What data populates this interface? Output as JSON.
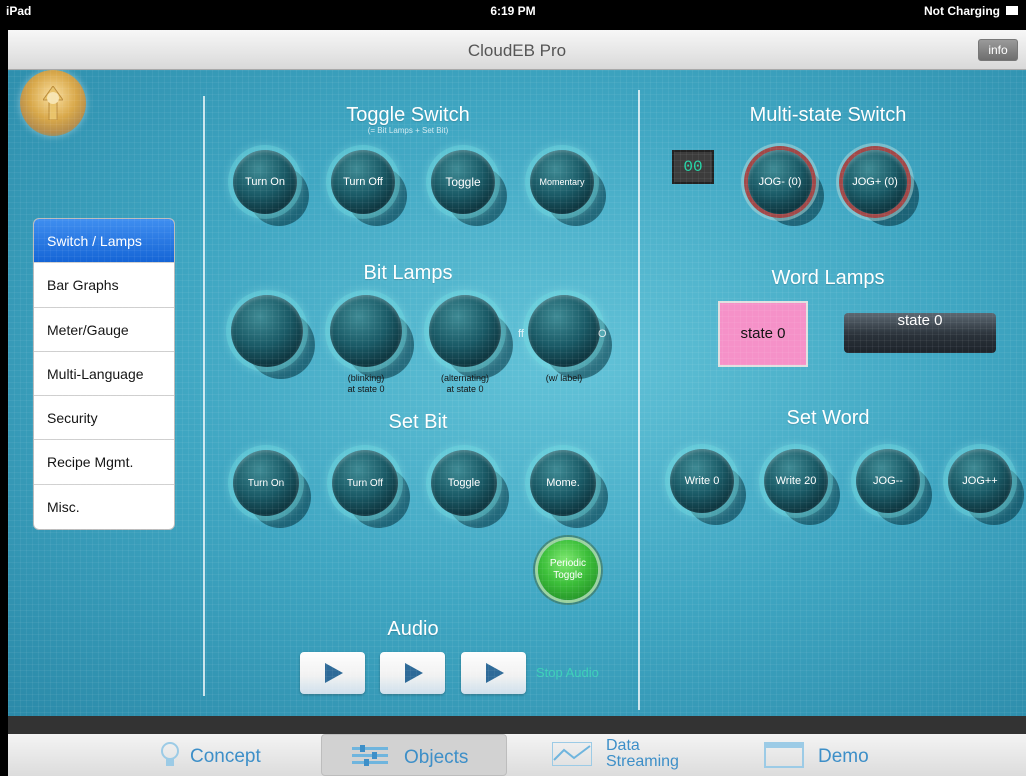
{
  "status_bar": {
    "device": "iPad",
    "time": "6:19 PM",
    "charging": "Not Charging"
  },
  "nav": {
    "title": "CloudEB Pro",
    "info_label": "info"
  },
  "menu": {
    "items": [
      "Switch / Lamps",
      "Bar Graphs",
      "Meter/Gauge",
      "Multi-Language",
      "Security",
      "Recipe Mgmt.",
      "Misc."
    ],
    "selected": "Switch / Lamps"
  },
  "toggle_switch": {
    "title": "Toggle Switch",
    "subtitle": "(= Bit Lamps + Set Bit)",
    "buttons": [
      "Turn On",
      "Turn Off",
      "Toggle",
      "Momentary"
    ]
  },
  "bit_lamps": {
    "title": "Bit Lamps",
    "captions": [
      {
        "line1": "(blinking)",
        "line2": "at state 0"
      },
      {
        "line1": "(alternating)",
        "line2": "at state 0"
      },
      {
        "line1": "(w/ label)",
        "line2": ""
      }
    ],
    "label_left": "ff",
    "label_right": "O"
  },
  "set_bit": {
    "title": "Set Bit",
    "buttons": [
      "Turn On",
      "Turn Off",
      "Toggle",
      "Mome."
    ],
    "periodic_line1": "Periodic",
    "periodic_line2": "Toggle"
  },
  "audio": {
    "title": "Audio",
    "stop_label": "Stop Audio"
  },
  "multi_state": {
    "title": "Multi-state Switch",
    "value": "00",
    "buttons": [
      "JOG- (0)",
      "JOG+ (0)"
    ]
  },
  "word_lamps": {
    "title": "Word Lamps",
    "pink_text": "state 0",
    "dark_text": "state 0"
  },
  "set_word": {
    "title": "Set Word",
    "buttons": [
      "Write 0",
      "Write 20",
      "JOG--",
      "JOG++"
    ]
  },
  "tabs": [
    {
      "label": "Concept",
      "icon": "lightbulb-icon"
    },
    {
      "label": "Objects",
      "icon": "sliders-icon"
    },
    {
      "label": "Data",
      "label2": "Streaming",
      "icon": "chart-icon"
    },
    {
      "label": "Demo",
      "icon": "window-icon"
    }
  ],
  "colors": {
    "accent": "#1565d6",
    "tab_text": "#3d8fc8",
    "background": "#3fa6c2",
    "pink_lamp": "#f591c8",
    "digit": "#25d6a8"
  }
}
